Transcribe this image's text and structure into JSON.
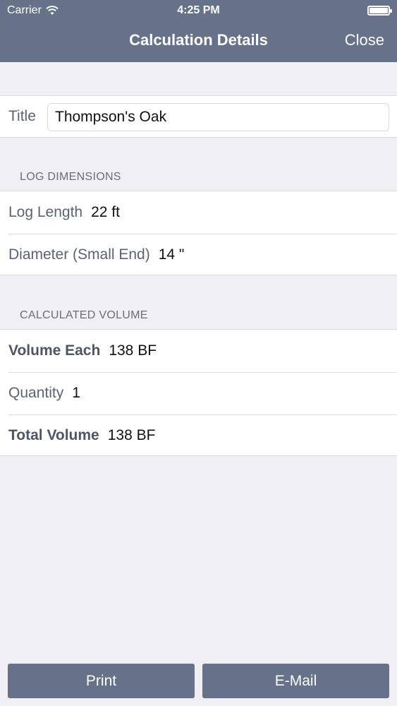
{
  "status_bar": {
    "carrier": "Carrier",
    "time": "4:25 PM"
  },
  "nav": {
    "title": "Calculation Details",
    "close_label": "Close"
  },
  "title_field": {
    "label": "Title",
    "value": "Thompson's Oak"
  },
  "log_dimensions": {
    "header": "LOG DIMENSIONS",
    "rows": [
      {
        "label": "Log Length",
        "value": "22 ft"
      },
      {
        "label": "Diameter (Small End)",
        "value": "14 \""
      }
    ]
  },
  "calculated_volume": {
    "header": "CALCULATED VOLUME",
    "rows": [
      {
        "label": "Volume Each",
        "value": "138 BF"
      },
      {
        "label": "Quantity",
        "value": "1"
      },
      {
        "label": "Total Volume",
        "value": "138 BF"
      }
    ]
  },
  "buttons": {
    "print_label": "Print",
    "email_label": "E-Mail"
  },
  "colors": {
    "nav_background": "#66718a",
    "page_background": "#efeff4"
  },
  "icons": [
    "wifi-icon",
    "battery-icon"
  ]
}
